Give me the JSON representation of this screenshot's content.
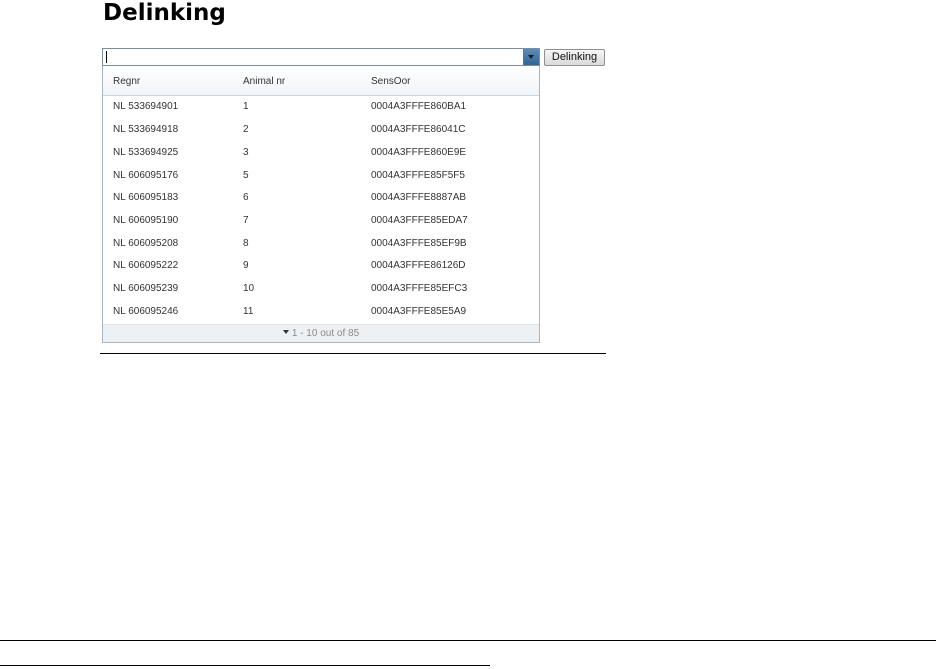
{
  "page": {
    "title": "Delinking"
  },
  "search": {
    "value": "",
    "placeholder": ""
  },
  "actions": {
    "delink_label": "Delinking"
  },
  "grid": {
    "columns": [
      "Regnr",
      "Animal nr",
      "SensOor"
    ],
    "rows": [
      [
        "NL 533694901",
        "1",
        "0004A3FFFE860BA1"
      ],
      [
        "NL 533694918",
        "2",
        "0004A3FFFE86041C"
      ],
      [
        "NL 533694925",
        "3",
        "0004A3FFFE860E9E"
      ],
      [
        "NL 606095176",
        "5",
        "0004A3FFFE85F5F5"
      ],
      [
        "NL 606095183",
        "6",
        "0004A3FFFE8887AB"
      ],
      [
        "NL 606095190",
        "7",
        "0004A3FFFE85EDA7"
      ],
      [
        "NL 606095208",
        "8",
        "0004A3FFFE85EF9B"
      ],
      [
        "NL 606095222",
        "9",
        "0004A3FFFE86126D"
      ],
      [
        "NL 606095239",
        "10",
        "0004A3FFFE85EFC3"
      ],
      [
        "NL 606095246",
        "11",
        "0004A3FFFE85E5A9"
      ]
    ],
    "pager": "1 - 10 out of 85"
  },
  "icons": {
    "combo_toggle": "chevron-down-icon",
    "pager_toggle": "caret-down-icon"
  },
  "colors": {
    "combo_button": "#2f6597",
    "header_border": "#c9d7e4",
    "footer_bg": "#eef1f4"
  }
}
